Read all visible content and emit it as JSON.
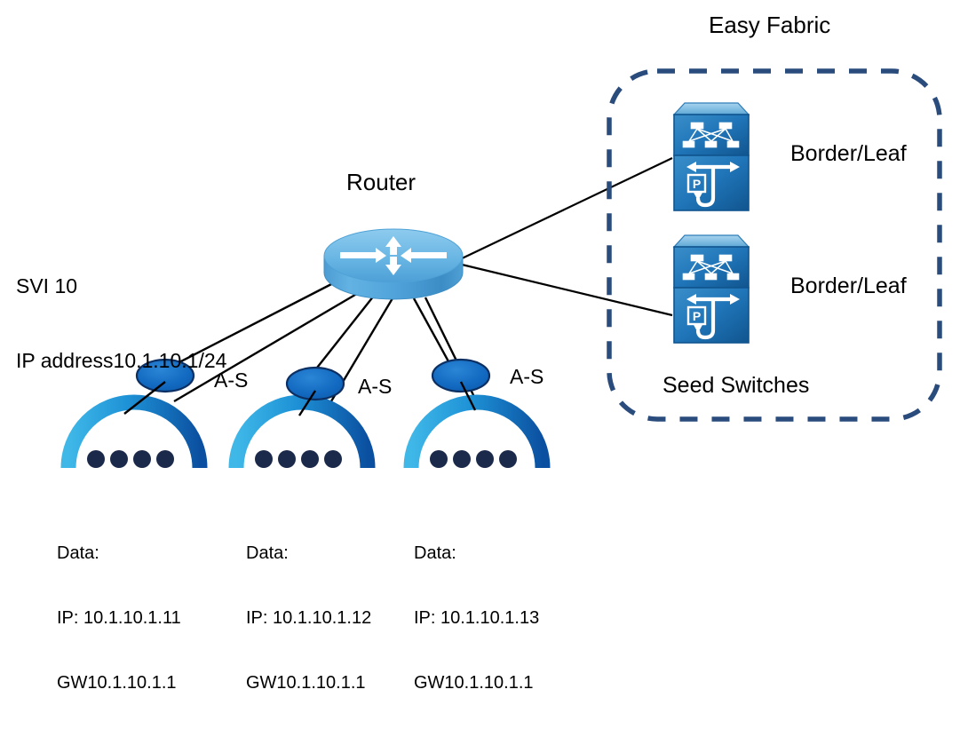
{
  "diagram": {
    "title_easy_fabric": "Easy Fabric",
    "router_title": "Router",
    "svi": {
      "line1": "SVI 10",
      "line2": "IP address10.1.10.1/24"
    },
    "fabric": {
      "seed_switches_label": "Seed Switches",
      "switches": [
        {
          "label": "Border/Leaf",
          "icon": "switch-router-icon"
        },
        {
          "label": "Border/Leaf",
          "icon": "switch-router-icon"
        }
      ]
    },
    "access_groups": [
      {
        "as_label": "A-S",
        "data": {
          "title": "Data:",
          "ip": "IP: 10.1.10.1.11",
          "gw": "GW10.1.10.1.1"
        },
        "host_dots": 4
      },
      {
        "as_label": "A-S",
        "data": {
          "title": "Data:",
          "ip": "IP: 10.1.10.1.12",
          "gw": "GW10.1.10.1.1"
        },
        "host_dots": 4
      },
      {
        "as_label": "A-S",
        "data": {
          "title": "Data:",
          "ip": "IP: 10.1.10.1.13",
          "gw": "GW10.1.10.1.1"
        },
        "host_dots": 4
      }
    ],
    "colors": {
      "fabric_border": "#2A4C7D",
      "router_body": "#4A9FD8",
      "router_top": "#6FBBE6",
      "switch_blue": "#1F7CC4",
      "switch_dark": "#15639F",
      "ellipse_fill": "#1269C0",
      "ellipse_stroke": "#0C2F63",
      "arc_light": "#25ADE3",
      "arc_dark": "#0B55A5",
      "host_dot": "#1B2A4A",
      "link_line": "#000000",
      "text": "#000000"
    }
  }
}
